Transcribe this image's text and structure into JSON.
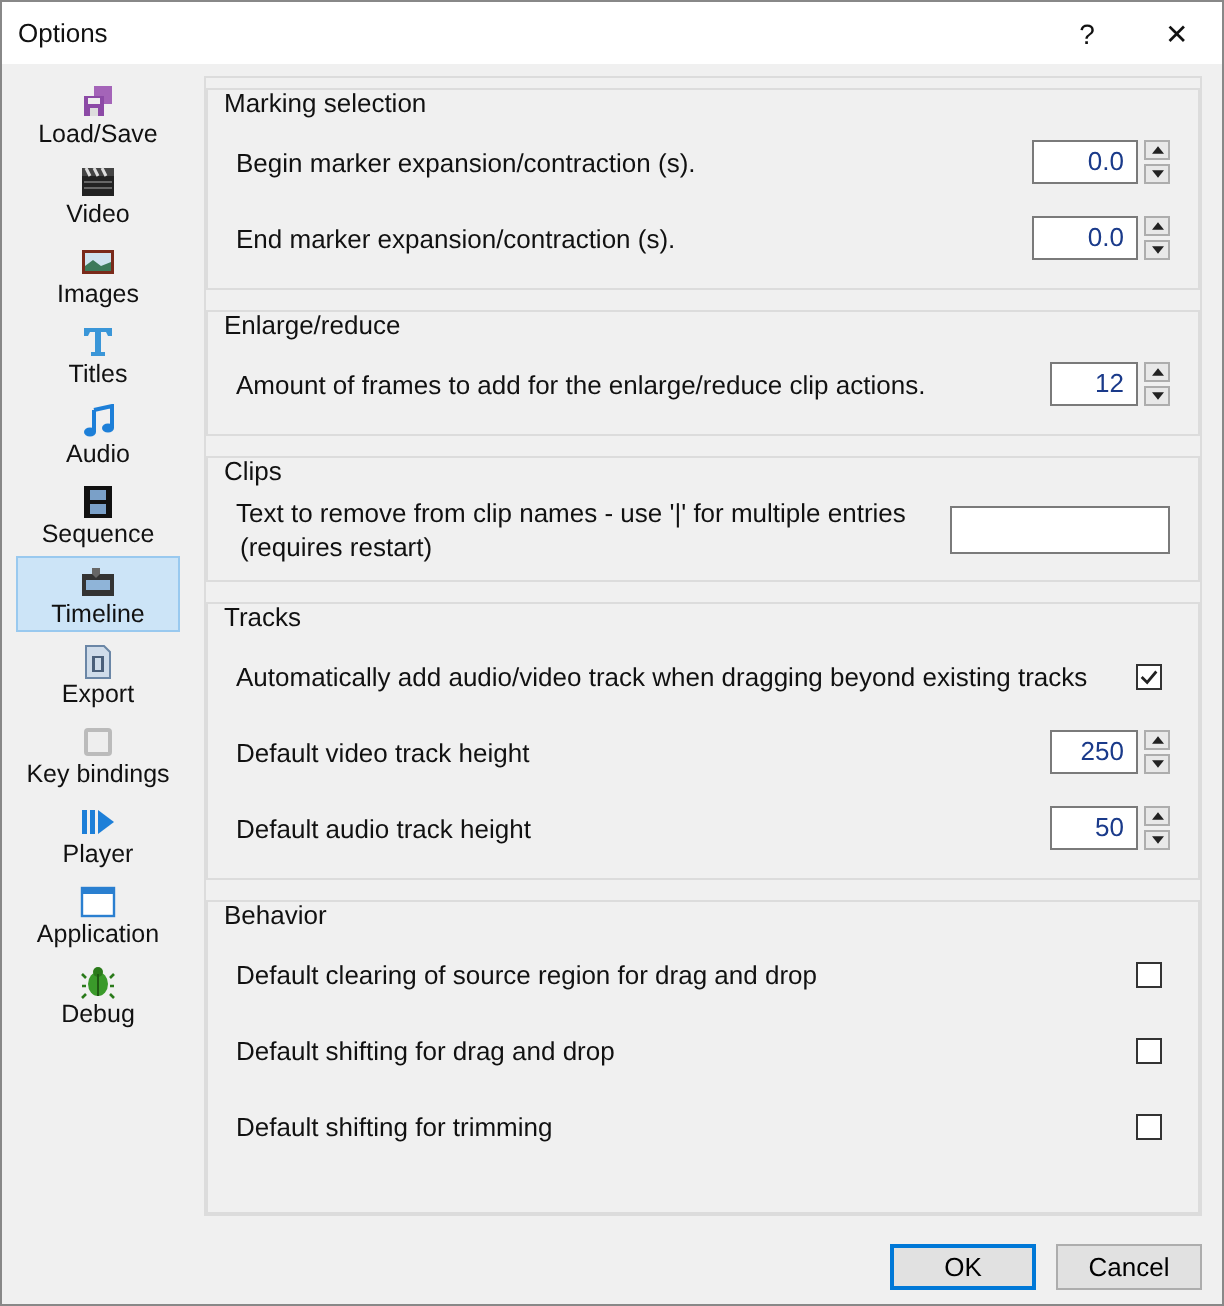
{
  "window": {
    "title": "Options",
    "help": "?",
    "close": "✕"
  },
  "sidebar": {
    "items": [
      {
        "label": "Load/Save",
        "selected": false
      },
      {
        "label": "Video",
        "selected": false
      },
      {
        "label": "Images",
        "selected": false
      },
      {
        "label": "Titles",
        "selected": false
      },
      {
        "label": "Audio",
        "selected": false
      },
      {
        "label": "Sequence",
        "selected": false
      },
      {
        "label": "Timeline",
        "selected": true
      },
      {
        "label": "Export",
        "selected": false
      },
      {
        "label": "Key bindings",
        "selected": false
      },
      {
        "label": "Player",
        "selected": false
      },
      {
        "label": "Application",
        "selected": false
      },
      {
        "label": "Debug",
        "selected": false
      }
    ]
  },
  "groups": [
    {
      "title": "Marking selection",
      "rows": [
        {
          "kind": "spin",
          "label": "Begin marker expansion/contraction (s).",
          "value": "0.0",
          "wide": true
        },
        {
          "kind": "spin",
          "label": "End marker expansion/contraction (s).",
          "value": "0.0",
          "wide": true
        }
      ]
    },
    {
      "title": "Enlarge/reduce",
      "rows": [
        {
          "kind": "spin",
          "label": "Amount of frames to add for the enlarge/reduce clip actions.",
          "value": "12",
          "wide": false
        }
      ]
    },
    {
      "title": "Clips",
      "rows": [
        {
          "kind": "text",
          "label": "Text to remove from clip names - use '|' for multiple entries",
          "note": "(requires restart)"
        }
      ]
    },
    {
      "title": "Tracks",
      "rows": [
        {
          "kind": "check",
          "label": "Automatically add audio/video track when dragging beyond existing tracks",
          "checked": true
        },
        {
          "kind": "spin",
          "label": "Default video track height",
          "value": "250",
          "wide": false
        },
        {
          "kind": "spin",
          "label": "Default audio track height",
          "value": "50",
          "wide": false
        }
      ]
    },
    {
      "title": "Behavior",
      "rows": [
        {
          "kind": "check",
          "label": "Default clearing of source region for drag and drop",
          "checked": false
        },
        {
          "kind": "check",
          "label": "Default shifting for drag and drop",
          "checked": false
        },
        {
          "kind": "check",
          "label": "Default shifting for trimming",
          "checked": false
        }
      ]
    }
  ],
  "buttons": [
    {
      "label": "OK",
      "default": true
    },
    {
      "label": "Cancel",
      "default": false
    }
  ]
}
